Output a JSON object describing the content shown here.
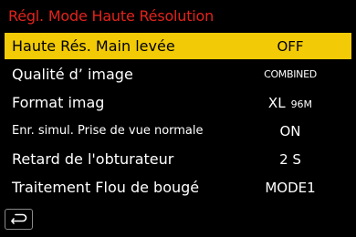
{
  "title": "Régl. Mode Haute Résolution",
  "menu": [
    {
      "label": "Haute Rés. Main levée",
      "value": "OFF"
    },
    {
      "label": "Qualité d’ image",
      "value": "COMBINED"
    },
    {
      "label": "Format imag",
      "value": "XL",
      "value_sub": "96M"
    },
    {
      "label": "Enr. simul. Prise de vue normale",
      "value": "ON"
    },
    {
      "label": "Retard de l'obturateur",
      "value": "2 S"
    },
    {
      "label": "Traitement Flou de bougé",
      "value": "MODE1"
    }
  ],
  "selected_index": 0,
  "back_icon": "return-arrow-icon",
  "colors": {
    "title": "#e3231b",
    "highlight": "#f2cb06",
    "background": "#000000"
  }
}
